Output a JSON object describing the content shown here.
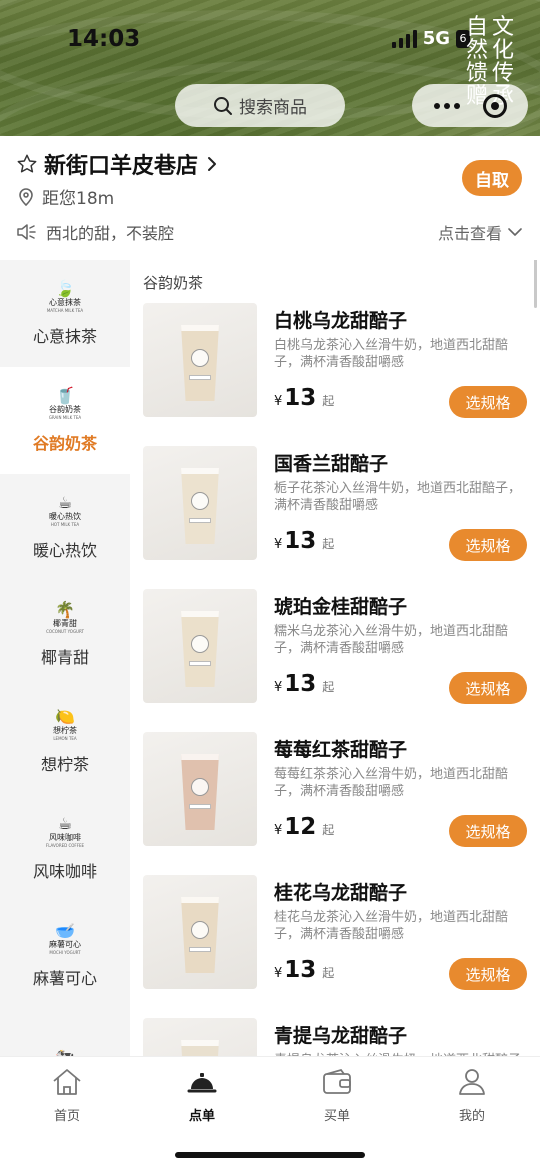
{
  "status_bar": {
    "time": "14:03",
    "network": "5G",
    "battery": "6"
  },
  "brand": {
    "col1": [
      "自",
      "然",
      "馈",
      "赠"
    ],
    "col2": [
      "文",
      "化",
      "传",
      "承"
    ]
  },
  "search": {
    "placeholder": "搜索商品"
  },
  "store": {
    "name": "新街口羊皮巷店",
    "distance": "距您18m",
    "pickup_label": "自取",
    "notice": "西北的甜，不装腔",
    "view_more": "点击查看"
  },
  "categories": [
    {
      "label": "心意抹茶",
      "logo_cn": "心意抹茶",
      "logo_en": "MATCHA MILK TEA",
      "logo_mark": "🍃",
      "active": false
    },
    {
      "label": "谷韵奶茶",
      "logo_cn": "谷韵奶茶",
      "logo_en": "GRAIN MILK TEA",
      "logo_mark": "🥤",
      "active": true
    },
    {
      "label": "暖心热饮",
      "logo_cn": "暖心热饮",
      "logo_en": "HOT MILK TEA",
      "logo_mark": "☕",
      "active": false
    },
    {
      "label": "椰青甜",
      "logo_cn": "椰青甜",
      "logo_en": "COCONUT YOGURT",
      "logo_mark": "🌴",
      "active": false
    },
    {
      "label": "想柠茶",
      "logo_cn": "想柠茶",
      "logo_en": "LEMON TEA",
      "logo_mark": "🍋",
      "active": false
    },
    {
      "label": "风味咖啡",
      "logo_cn": "风味咖啡",
      "logo_en": "FLAVORED COFFEE",
      "logo_mark": "☕",
      "active": false
    },
    {
      "label": "麻薯可心",
      "logo_cn": "麻薯可心",
      "logo_en": "MOCHI YOGURT",
      "logo_mark": "🥣",
      "active": false
    },
    {
      "label": "",
      "logo_cn": "",
      "logo_en": "",
      "logo_mark": "🐄",
      "active": false
    }
  ],
  "section_title": "谷韵奶茶",
  "products": [
    {
      "name": "白桃乌龙甜醅子",
      "desc": "白桃乌龙茶沁入丝滑牛奶，地道西北甜醅子，满杯清香酸甜嚼感",
      "currency": "¥",
      "price": "13",
      "suffix": "起",
      "button": "选规格",
      "liquid": "#e9dcc6"
    },
    {
      "name": "国香兰甜醅子",
      "desc": "栀子花茶沁入丝滑牛奶，地道西北甜醅子，满杯清香酸甜嚼感",
      "currency": "¥",
      "price": "13",
      "suffix": "起",
      "button": "选规格",
      "liquid": "#ece2cf"
    },
    {
      "name": "琥珀金桂甜醅子",
      "desc": "糯米乌龙茶沁入丝滑牛奶，地道西北甜醅子，满杯清香酸甜嚼感",
      "currency": "¥",
      "price": "13",
      "suffix": "起",
      "button": "选规格",
      "liquid": "#ebe0cb"
    },
    {
      "name": "莓莓红茶甜醅子",
      "desc": "莓莓红茶茶沁入丝滑牛奶，地道西北甜醅子，满杯清香酸甜嚼感",
      "currency": "¥",
      "price": "12",
      "suffix": "起",
      "button": "选规格",
      "liquid": "#e0c1ae"
    },
    {
      "name": "桂花乌龙甜醅子",
      "desc": "桂花乌龙茶沁入丝滑牛奶，地道西北甜醅子，满杯清香酸甜嚼感",
      "currency": "¥",
      "price": "13",
      "suffix": "起",
      "button": "选规格",
      "liquid": "#e8dac4"
    },
    {
      "name": "青提乌龙甜醅子",
      "desc": "青提乌龙茶沁入丝滑牛奶，地道西北甜醅子",
      "currency": "¥",
      "price": "",
      "suffix": "",
      "button": "",
      "liquid": "#e9e0cf"
    }
  ],
  "tabs": [
    {
      "label": "首页",
      "icon": "home-icon",
      "active": false
    },
    {
      "label": "点单",
      "icon": "order-bell-icon",
      "active": true
    },
    {
      "label": "买单",
      "icon": "wallet-icon",
      "active": false
    },
    {
      "label": "我的",
      "icon": "user-icon",
      "active": false
    }
  ],
  "colors": {
    "accent": "#e88a2e",
    "active_text": "#e07b25",
    "banner": "#5f7537"
  }
}
